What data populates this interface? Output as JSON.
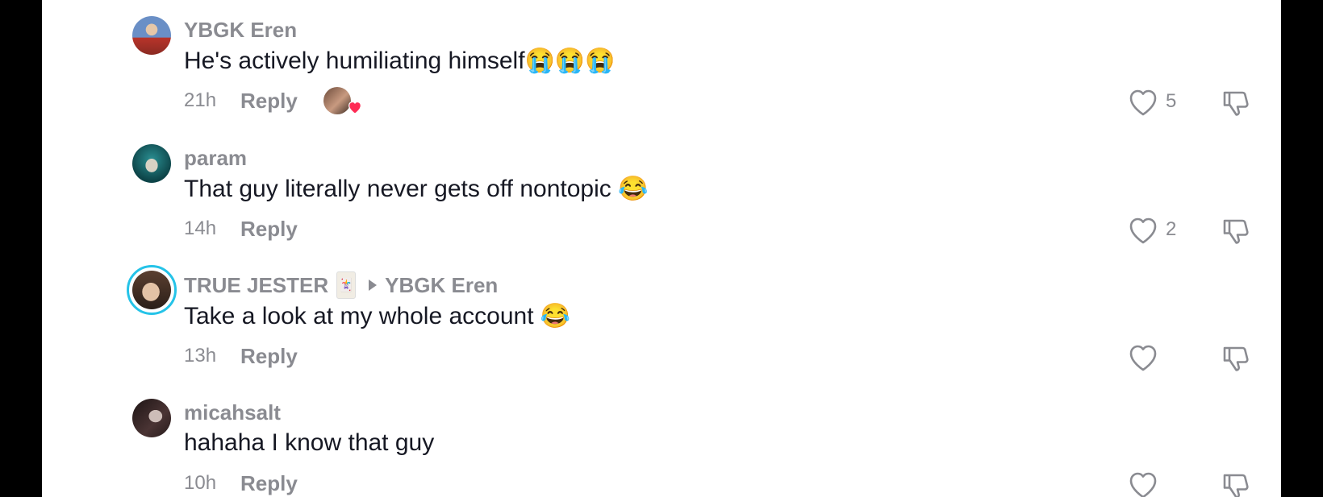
{
  "comments": [
    {
      "username": "YBGK Eren",
      "text": "He's actively humiliating himself😭😭😭",
      "time": "21h",
      "reply": "Reply",
      "likes": "5",
      "avatar_colors": [
        "#5b7fb8",
        "#c23a2b"
      ]
    },
    {
      "username": "param",
      "text": "That guy literally never gets off nontopic 😂",
      "time": "14h",
      "reply": "Reply",
      "likes": "2",
      "avatar_colors": [
        "#1e6b74",
        "#0b1a1c"
      ]
    },
    {
      "username": "TRUE JESTER",
      "reply_to": "YBGK Eren",
      "text": "Take a look at my whole account 😂",
      "time": "13h",
      "reply": "Reply",
      "likes": "",
      "avatar_colors": [
        "#d9b9a0",
        "#3b2a22"
      ]
    },
    {
      "username": "micahsalt",
      "text": "hahaha I know that guy",
      "time": "10h",
      "reply": "Reply",
      "likes": "",
      "avatar_colors": [
        "#3a2b2b",
        "#c9b8b3"
      ]
    }
  ],
  "icons": {
    "like": "heart-outline-icon",
    "dislike": "thumbs-down-outline-icon",
    "reply_arrow": "caret-right-icon",
    "liked_by_creator": "heart-filled-icon"
  },
  "colors": {
    "muted_text": "#8a8b91",
    "body_text": "#161823",
    "story_ring": "#25c3e8",
    "heart_badge": "#fe2c55"
  }
}
